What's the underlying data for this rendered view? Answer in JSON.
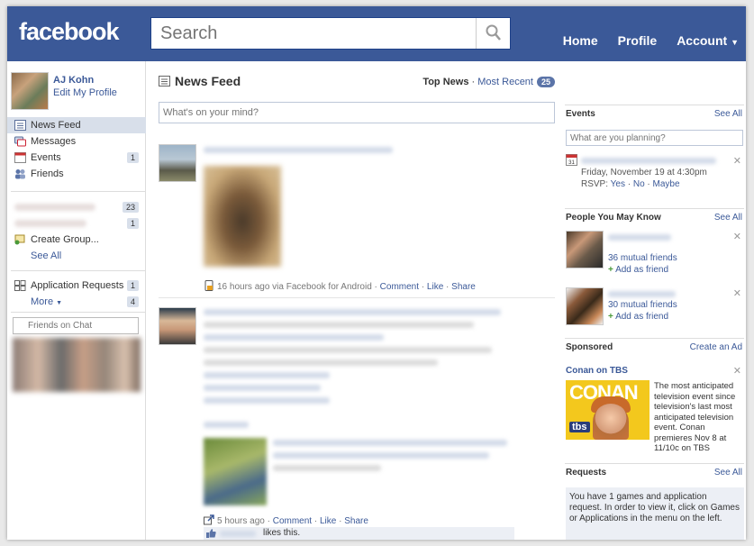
{
  "header": {
    "logo": "facebook",
    "search_placeholder": "Search",
    "nav": [
      "Home",
      "Profile",
      "Account"
    ]
  },
  "profile": {
    "name": "AJ Kohn",
    "edit_link": "Edit My Profile"
  },
  "sidebar": {
    "items": [
      {
        "label": "News Feed",
        "count": ""
      },
      {
        "label": "Messages",
        "count": ""
      },
      {
        "label": "Events",
        "count": "1"
      },
      {
        "label": "Friends",
        "count": ""
      }
    ],
    "groups": [
      {
        "count": "23"
      },
      {
        "count": "1"
      }
    ],
    "create_group": "Create Group...",
    "see_all": "See All",
    "app_requests": {
      "label": "Application Requests",
      "count": "1"
    },
    "more": {
      "label": "More",
      "count": "4"
    },
    "chat_placeholder": "Friends on Chat"
  },
  "feed": {
    "title": "News Feed",
    "tab_top": "Top News",
    "tab_sep": " · ",
    "tab_recent": "Most Recent",
    "recent_count": "25",
    "status_placeholder": "What's on your mind?",
    "stories": [
      {
        "time": "16 hours ago via Facebook for Android",
        "actions": [
          "Comment",
          "Like",
          "Share"
        ]
      },
      {
        "time": "5 hours ago",
        "actions": [
          "Comment",
          "Like",
          "Share"
        ],
        "likes_text": "likes this."
      }
    ]
  },
  "right": {
    "events": {
      "title": "Events",
      "see_all": "See All",
      "input_placeholder": "What are you planning?",
      "event_date": "Friday, November 19 at 4:30pm",
      "rsvp_label": "RSVP:",
      "rsvp_options": [
        "Yes",
        "No",
        "Maybe"
      ],
      "calendar_day": "31"
    },
    "pymk": {
      "title": "People You May Know",
      "see_all": "See All",
      "people": [
        {
          "mutual": "36 mutual friends",
          "add": "Add as friend"
        },
        {
          "mutual": "30 mutual friends",
          "add": "Add as friend"
        }
      ]
    },
    "sponsored": {
      "title": "Sponsored",
      "create_ad": "Create an Ad",
      "ad_title": "Conan on TBS",
      "ad_text": "The most anticipated television event since television's last most anticipated television event. Conan premieres Nov 8 at 11/10c on TBS",
      "ad_image_word": "CONAN",
      "ad_image_logo": "tbs"
    },
    "requests": {
      "title": "Requests",
      "see_all": "See All",
      "text": "You have 1 games and application request. In order to view it, click on Games or Applications in the menu on the left."
    }
  },
  "colors": {
    "brand": "#3b5998",
    "link": "#3b5998",
    "active_row": "#d8dfea"
  }
}
